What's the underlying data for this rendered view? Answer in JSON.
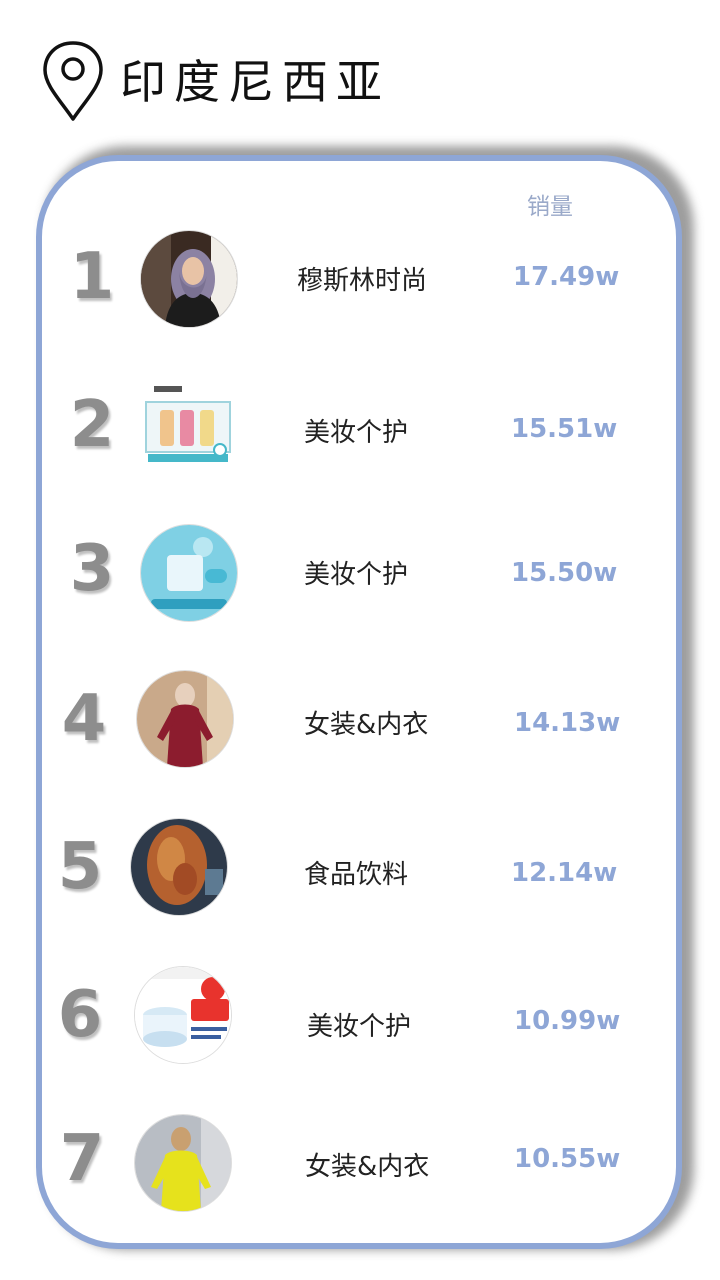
{
  "header": {
    "title": "印度尼西亚",
    "icon": "location-pin-icon"
  },
  "table": {
    "column_sales": "销量",
    "accent_color": "#8ea6d6",
    "rows": [
      {
        "rank": "1",
        "category": "穆斯林时尚",
        "sales": "17.49w",
        "thumb": "hijab-woman-photo"
      },
      {
        "rank": "2",
        "category": "美妆个护",
        "sales": "15.51w",
        "thumb": "skincare-tubes-photo"
      },
      {
        "rank": "3",
        "category": "美妆个护",
        "sales": "15.50w",
        "thumb": "whitening-soap-photo"
      },
      {
        "rank": "4",
        "category": "女装&内衣",
        "sales": "14.13w",
        "thumb": "red-tunic-photo"
      },
      {
        "rank": "5",
        "category": "食品饮料",
        "sales": "12.14w",
        "thumb": "snack-food-photo"
      },
      {
        "rank": "6",
        "category": "美妆个护",
        "sales": "10.99w",
        "thumb": "ceramide-cream-photo"
      },
      {
        "rank": "7",
        "category": "女装&内衣",
        "sales": "10.55w",
        "thumb": "yellow-blouse-photo"
      }
    ]
  }
}
